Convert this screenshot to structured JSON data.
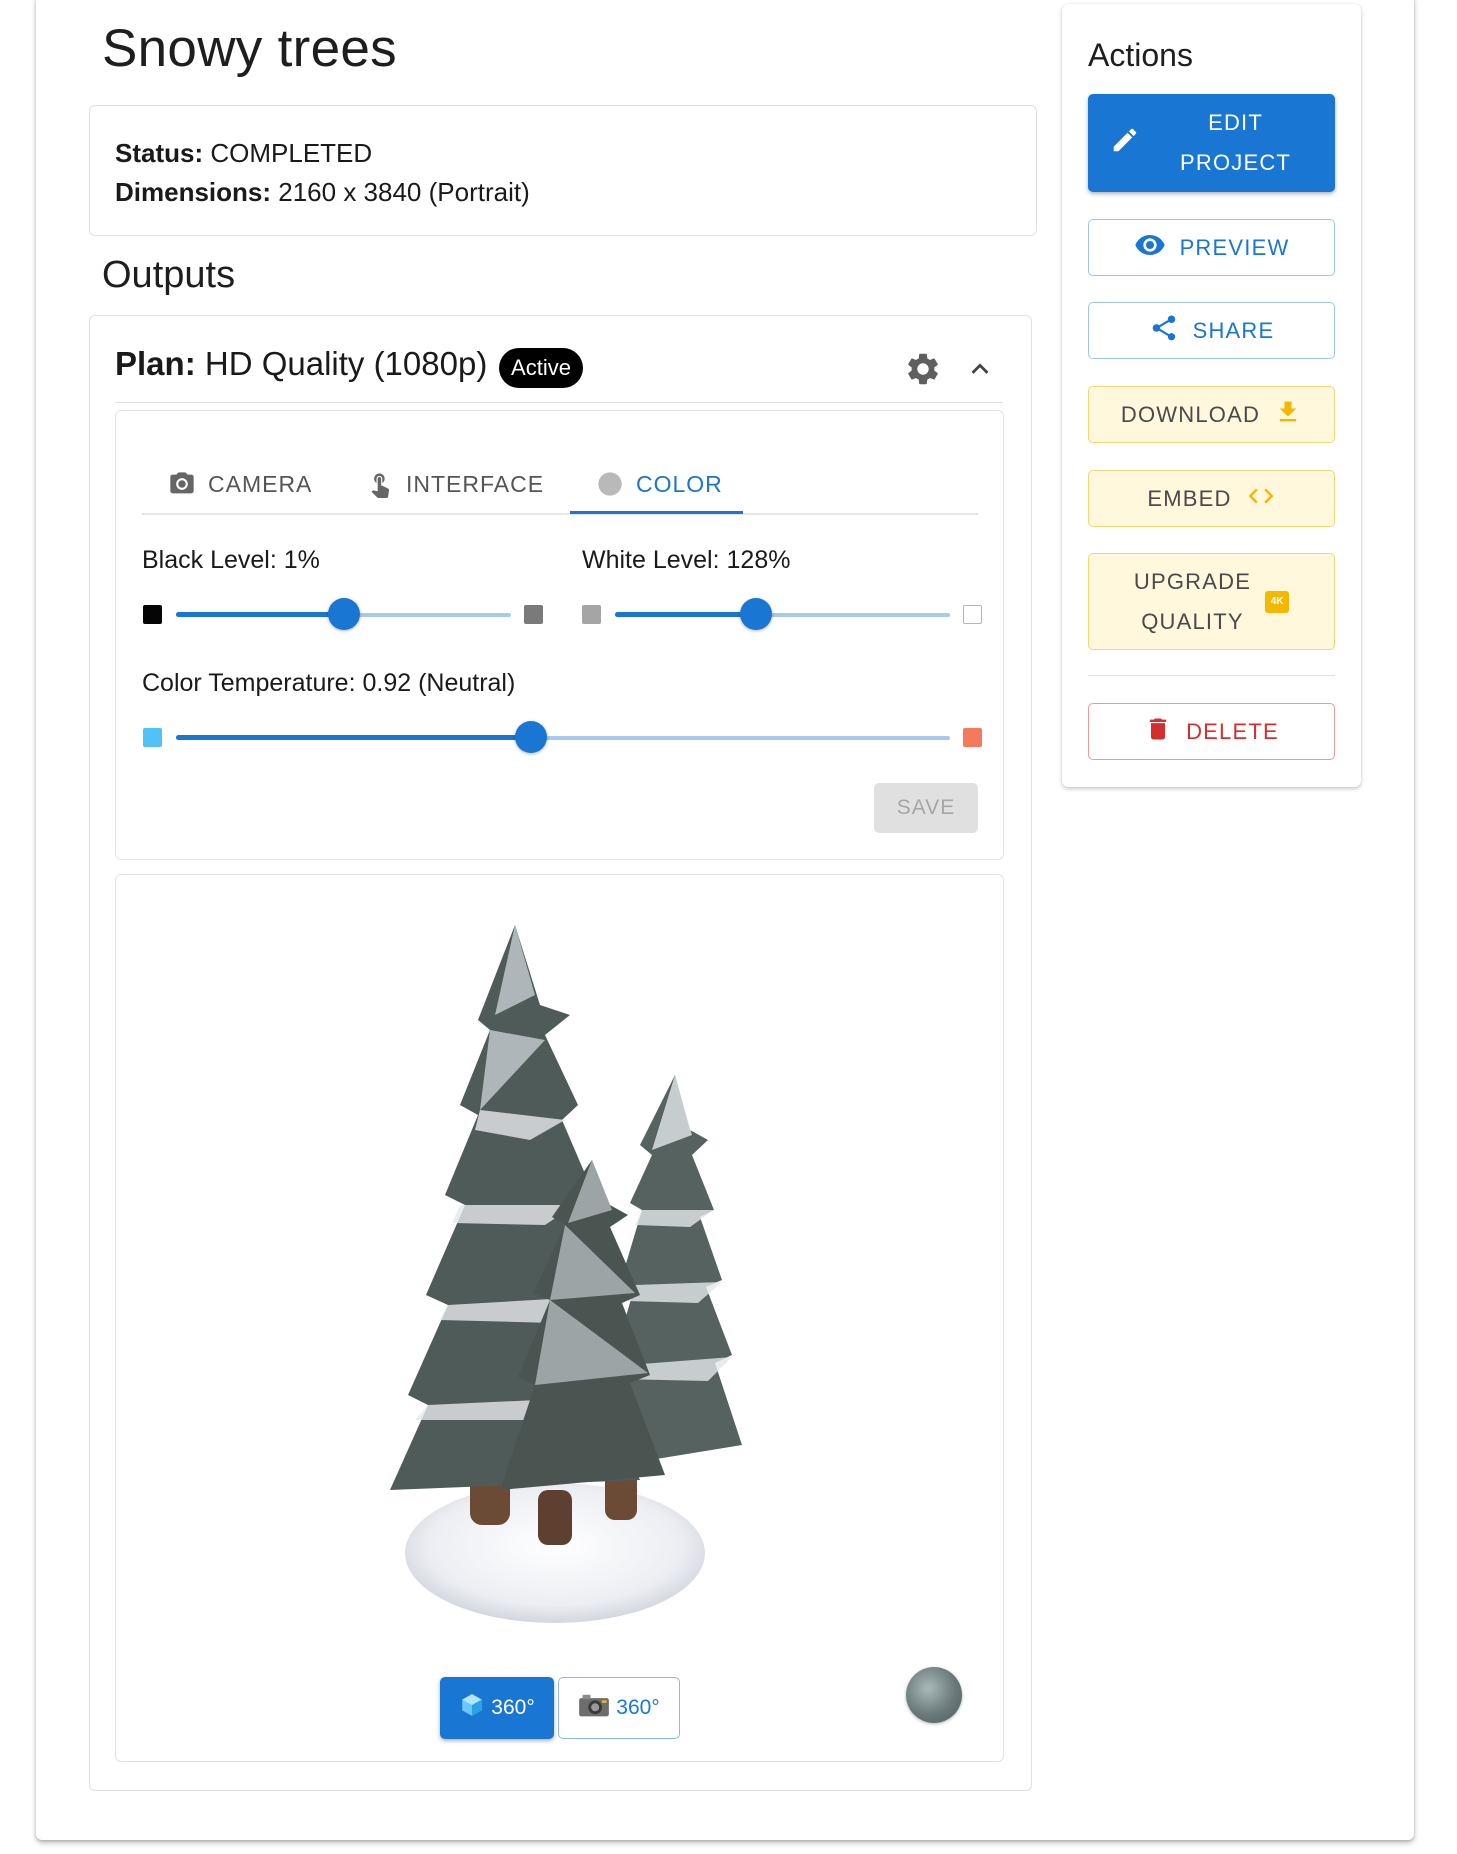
{
  "project": {
    "title": "Snowy trees",
    "status_label": "Status:",
    "status_value": "COMPLETED",
    "dimensions_label": "Dimensions:",
    "dimensions_value": "2160 x 3840 (Portrait)"
  },
  "outputs": {
    "heading": "Outputs",
    "plan_label": "Plan:",
    "plan_value": "HD Quality (1080p)",
    "plan_badge": "Active"
  },
  "tabs": [
    {
      "label": "CAMERA",
      "icon": "camera-icon",
      "active": false
    },
    {
      "label": "INTERFACE",
      "icon": "touch-icon",
      "active": false
    },
    {
      "label": "COLOR",
      "icon": "color-circle-icon",
      "active": true
    }
  ],
  "sliders": {
    "black_level": {
      "label": "Black Level: 1%",
      "value_fraction": 0.5
    },
    "white_level": {
      "label": "White Level: 128%",
      "value_fraction": 0.42
    },
    "color_temperature": {
      "label": "Color Temperature: 0.92 (Neutral)",
      "value_fraction": 0.46
    }
  },
  "save_label": "SAVE",
  "viewer": {
    "button_3d": {
      "label": "360°",
      "icon": "cube-icon"
    },
    "button_photo": {
      "label": "360°",
      "icon": "photo-camera-icon"
    }
  },
  "actions": {
    "title": "Actions",
    "edit_line1": "EDIT",
    "edit_line2": "PROJECT",
    "preview": "PREVIEW",
    "share": "SHARE",
    "download": "DOWNLOAD",
    "embed": "EMBED",
    "upgrade_line1": "UPGRADE",
    "upgrade_line2": "QUALITY",
    "upgrade_badge": "4K",
    "delete": "DELETE"
  },
  "colors": {
    "primary": "#1976d2",
    "danger": "#d32f2f",
    "warning_bg": "#fff8dd",
    "warning_accent": "#f5b800"
  }
}
